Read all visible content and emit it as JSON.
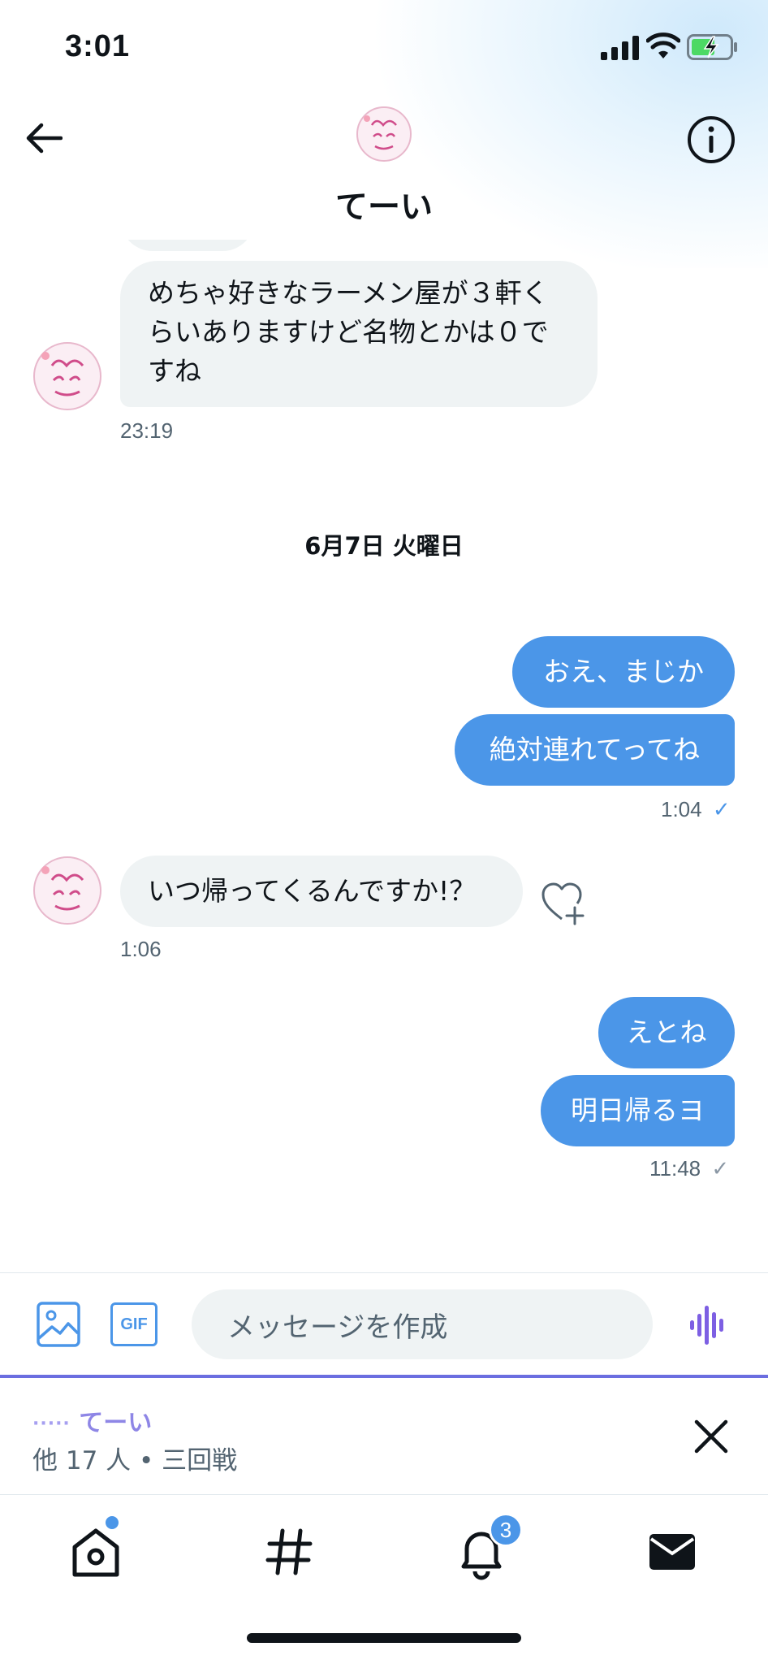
{
  "status_bar": {
    "time": "3:01"
  },
  "header": {
    "name": "てーい"
  },
  "messages": [
    {
      "text": "めちゃ好きなラーメン屋が３軒く\nらいありますけど名物とかは０で\nすね",
      "time": "23:19"
    },
    {
      "date": "6月7日 火曜日"
    },
    {
      "text": "おえ、まじか"
    },
    {
      "text": "絶対連れてってね",
      "time": "1:04",
      "status": "✓"
    },
    {
      "text": "いつ帰ってくるんですか!？",
      "time": "1:06"
    },
    {
      "text": "えとね"
    },
    {
      "text": "明日帰るヨ",
      "time": "11:48",
      "status": "✓"
    }
  ],
  "composer": {
    "placeholder": "メッセージを作成",
    "gif_label": "GIF"
  },
  "space": {
    "host": "てーい",
    "dots": "·····",
    "subtitle": "他 17 人 • 三回戦"
  },
  "tabbar": {
    "notification_count": "3"
  },
  "colors": {
    "accent": "#4b96e8",
    "space": "#8e86e6",
    "bubble_in": "#eff3f4"
  },
  "icons": [
    "back-arrow-icon",
    "info-icon",
    "image-icon",
    "voice-icon",
    "close-icon",
    "home-icon",
    "hashtag-icon",
    "bell-icon",
    "mail-icon",
    "heart-plus-icon"
  ]
}
